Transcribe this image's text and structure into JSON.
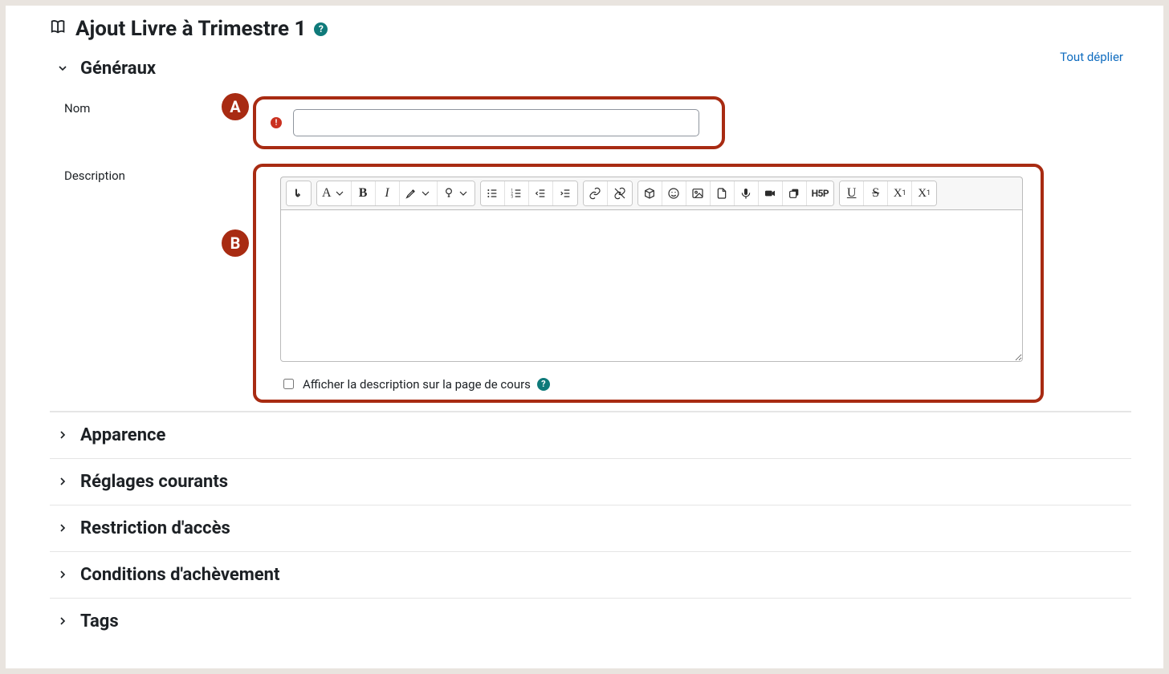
{
  "page": {
    "title": "Ajout Livre à Trimestre 1"
  },
  "actions": {
    "expand_all": "Tout déplier"
  },
  "callouts": {
    "a": "A",
    "b": "B"
  },
  "sections": {
    "general": {
      "title": "Généraux"
    },
    "appearance": {
      "title": "Apparence"
    },
    "common": {
      "title": "Réglages courants"
    },
    "restrict": {
      "title": "Restriction d'accès"
    },
    "completion": {
      "title": "Conditions d'achèvement"
    },
    "tags": {
      "title": "Tags"
    }
  },
  "form": {
    "name_label": "Nom",
    "name_value": "",
    "desc_label": "Description",
    "show_desc_label": "Afficher la description sur la page de cours"
  },
  "toolbar": {
    "expand": "expand-toolbar",
    "paragraph": "A",
    "bold": "B",
    "italic": "I",
    "highlight": "highlight",
    "help": "help",
    "ul": "bullet-list",
    "ol": "numbered-list",
    "outdent": "outdent",
    "indent": "indent",
    "link": "link",
    "unlink": "unlink",
    "cube": "equation",
    "emoji": "emoji",
    "image": "image",
    "file": "file",
    "mic": "record-audio",
    "video": "record-video",
    "paste": "manage-files",
    "h5p": "H5P",
    "underline": "U",
    "strike": "S",
    "sub": "X",
    "sub_s": "1",
    "sup": "X",
    "sup_s": "1"
  }
}
